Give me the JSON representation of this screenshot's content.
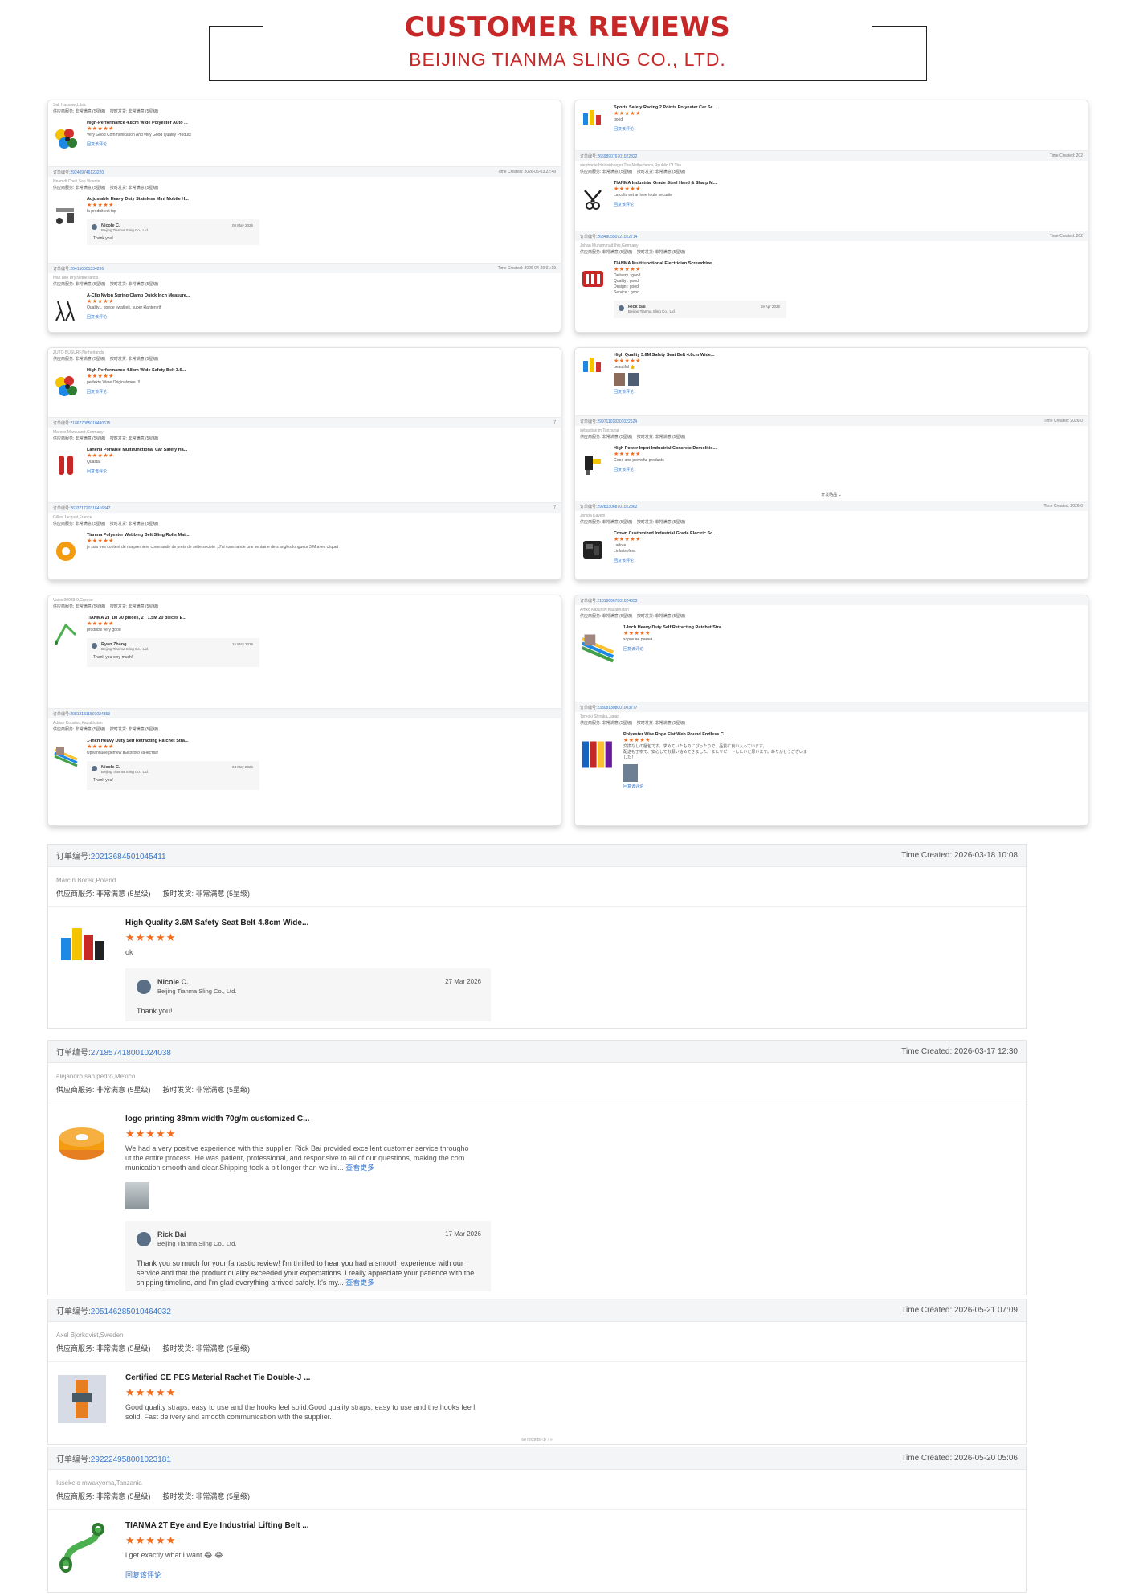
{
  "header": {
    "title": "CUSTOMER REVIEWS",
    "subtitle": "BEIJING TIANMA SLING CO., LTD."
  },
  "labels": {
    "service": "供应商服务: 非常满意 (5星级)",
    "delivery": "按时发货: 非常满意 (5星级)",
    "order_prefix": "订单编号:",
    "reply_link": "回复该评论",
    "company": "Beijing Tianma Sling Co., Ltd.",
    "stars": "★★★★★",
    "show_more": "查看更多"
  },
  "cards": {
    "c1": {
      "b1": {
        "reviewer": "Sali Hassawi,Libia",
        "product": "High-Performance 4.8cm Wide Polyester Auto ...",
        "review": "Very Good Communication And very Good Quality Product"
      },
      "b2": {
        "order": "292409746123220",
        "time": "Time Created: 2026-05-03 22:48",
        "reviewer": "Nnamdi Chefi,Sao Vicente",
        "product": "Adjustable Heavy Duty Stainless Mini Mobile H...",
        "review": "la produit est top",
        "reply_name": "Nicole C.",
        "reply_date": "08 May 2026",
        "reply_msg": "Thank you!"
      },
      "b3": {
        "order": "204150001334236",
        "time": "Time Created: 2026-04-29 01:19",
        "reviewer": "Ivan den Dry,Netherlands",
        "product": "A-Clip Nylon Spring Clamp Quick Inch Measure...",
        "review": "Quality... goede kwaliteit, super klantenrrif"
      }
    },
    "c2": {
      "b1": {
        "product": "Sports Safety Racing 2 Points Polyester Car Se...",
        "review": "good"
      },
      "b2": {
        "order": "266989076701022822",
        "time": "Time Created: 202",
        "reviewer": "stephanie Heldenberger,The Netherlands Rpublic Of The",
        "product": "TIANMA Industrial Grade Steel Hand & Sharp M...",
        "review": "La colis est arrivee toute securite"
      },
      "b3": {
        "order": "263480550721022714",
        "time": "Time Created: 202",
        "reviewer": "Johan Muhammad Ihis,Germany",
        "product": "TIANMA Multifunctional Electrician Screwdrive...",
        "review": "Delivery : good\nQuality : good\nDesign : good\nService : good",
        "reply_name": "Rick Bai",
        "reply_date": "19 Apr 2026"
      }
    },
    "c3": {
      "b1": {
        "reviewer": "ZUTO BUSURF,Netherlands",
        "product": "High-Performance 4.8cm Wide Safety Belt 3.6...",
        "review": "perfekte Ware Originalware !!!"
      },
      "b2": {
        "order": "218677085010490675",
        "time": "7",
        "reviewer": "Marcos Marquardt,Germany",
        "product": "Lanemi Portable Multifunctional Car Safety Ha...",
        "review": "Qualitat"
      },
      "b3": {
        "order": "263371720316416347",
        "time": "7",
        "reviewer": "Gilles Jacquot,France",
        "product": "Tianma Polyester Webbing Belt Sling Rolls Mat...",
        "review": "je suis tres content de ma premiere commande de prets de sette societe , J'ai commande une sentaine de s angles longueur 3 M avec cliquet"
      }
    },
    "c4": {
      "b1": {
        "product": "High Quality 3.6M Safety Seat Belt 4.8cm Wide...",
        "review": "beautiful 👍"
      },
      "b2": {
        "order": "299711018301022624",
        "time": "Time Created: 2026-0",
        "reviewer": "sebastian m,Tanzania",
        "product": "High Power Input Industrial Concrete Demolitio...",
        "review": "Good and powerful products",
        "more": "开发略品 ⌄"
      },
      "b3": {
        "order": "292803068701022862",
        "time": "Time Created: 2026-0",
        "reviewer": "Jonida Kaveni",
        "product": "Crown Customized Industrial Grade Electric Sc...",
        "review": "i adore\nLinfalisofess"
      }
    },
    "c5": {
      "b1": {
        "reviewer": "Vaios 90089-9,Greece",
        "product": "TIANMA 2T 1M 30 pieces, 2T 1.5M 20 pieces E...",
        "review": "products very good",
        "reply_name": "Ryan Zhang",
        "reply_date": "15 May 2026",
        "reply_msg": "Thank you very much!"
      },
      "b2": {
        "order": "298121311501024353",
        "time": "",
        "reviewer": "Adrian Koustou,Kazakhstan",
        "product": "1-Inch Heavy Duty Self Retracting Ratchet Stra...",
        "review": "Upeannuoe pemew высокого качества!",
        "reply_name": "Nicole C.",
        "reply_date": "04 May 2026",
        "reply_msg": "Thank you!"
      }
    },
    "c6": {
      "b1": {
        "order": "218186067801024353",
        "reviewer": "Amko Kasunov,Kazakhstan",
        "product": "1-Inch Heavy Duty Self Retracting Ratchet Stra...",
        "review": "хорошие ремни"
      },
      "b2": {
        "order": "233081308001003777",
        "reviewer": "Tomoki Shiraka,Japan",
        "product": "Polyester Wire Rope Flat Web Round Endless C...",
        "review": "交換なしの梱包です。求めていたものにぴったりで、品質に良い入っています。\n配送も丁寧で、安心してお願い始めてきました。またリピートしたいと思います。ありがとうございま\nした！"
      }
    }
  },
  "large_reviews": [
    {
      "order": "20213684501045411",
      "time": "Time Created: 2026-03-18 10:08",
      "reviewer": "Marcin Borek,Poland",
      "product": "High Quality 3.6M Safety Seat Belt 4.8cm Wide...",
      "review": "ok",
      "reply_name": "Nicole C.",
      "reply_date": "27 Mar 2026",
      "reply_msg": "Thank you!"
    },
    {
      "order": "271857418001024038",
      "time": "Time Created: 2026-03-17 12:30",
      "reviewer": "alejandro san pedro,Mexico",
      "product": "logo printing 38mm width 70g/m customized C...",
      "review": "We had a very positive experience with this supplier. Rick Bai provided excellent customer service througho ut the entire process. He was patient, professional, and responsive to all of our questions, making the com munication smooth and clear.Shipping took a bit longer than we ini...",
      "reply_name": "Rick Bai",
      "reply_date": "17 Mar 2026",
      "reply_msg": "Thank you so much for your fantastic review! I'm thrilled to hear you had a smooth experience with our service and that the product quality exceeded your expectations. I really appreciate your patience with the shipping timeline, and I'm glad everything arrived safely. It's my..."
    },
    {
      "order": "205146285010464032",
      "time": "Time Created: 2026-05-21 07:09",
      "reviewer": "Axel Bjorkqvist,Sweden",
      "product": "Certified CE PES Material Rachet Tie Double-J ...",
      "review": "Good quality straps, easy to use and the hooks feel solid.Good quality straps, easy to use and the hooks fee l solid. Fast delivery and smooth communication with the supplier.",
      "pager": "60 records  ‹1›  ›  »"
    },
    {
      "order": "292224958001023181",
      "time": "Time Created: 2026-05-20 05:06",
      "reviewer": "Iusekelo mwakyoma,Tanzania",
      "product": "TIANMA 2T Eye and Eye Industrial Lifting Belt ...",
      "review": "i get exactly what I want 😂 😂"
    }
  ],
  "colors": {
    "brand_red": "#c62828",
    "star_orange": "#f36b1c",
    "link_blue": "#3a78c9"
  },
  "icons": [
    "user-avatar-icon",
    "product-thumbnail",
    "star-icon"
  ]
}
